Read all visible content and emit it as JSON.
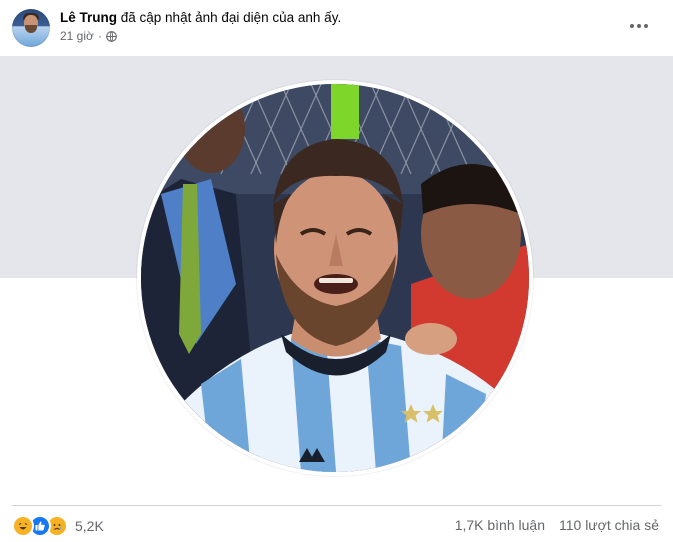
{
  "post": {
    "author": "Lê Trung",
    "action": "đã cập nhật ảnh đại diện của anh ấy.",
    "time": "21 giờ",
    "audience_icon": "globe-icon",
    "menu_icon": "more-options-icon"
  },
  "reactions": {
    "icons": [
      "haha-icon",
      "like-icon",
      "sad-icon"
    ],
    "count": "5,2K"
  },
  "stats": {
    "comments": "1,7K bình luận",
    "shares": "110 lượt chia sẻ"
  },
  "colors": {
    "cover": "#e4e6eb",
    "like": "#1877f2",
    "emoji": "#f7b125",
    "secondary_text": "#65676b"
  }
}
